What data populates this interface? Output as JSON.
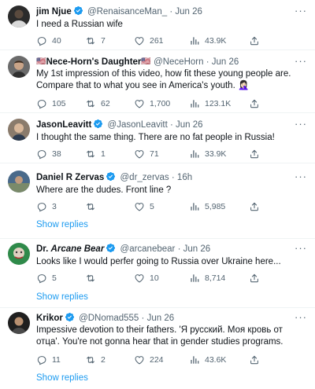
{
  "tweets": [
    {
      "name": "jim Njue",
      "handle": "@RenaisanceMan_",
      "date": "Jun 26",
      "text": "I need a Russian wife",
      "replies": "40",
      "retweets": "7",
      "likes": "261",
      "views": "43.9K"
    },
    {
      "name": "Nece-Horn's Daughter",
      "handle": "@NeceHorn",
      "date": "Jun 26",
      "text": "My 1st impression of this video, how fit these young people are. Compare that to what you see in America's youth. 🤦🏻‍♀️",
      "replies": "105",
      "retweets": "62",
      "likes": "1,700",
      "views": "123.1K"
    },
    {
      "name": "JasonLeavitt",
      "handle": "@JasonLeavitt",
      "date": "Jun 26",
      "text": "I thought the same thing. There are no fat people in Russia!",
      "replies": "38",
      "retweets": "1",
      "likes": "71",
      "views": "33.9K"
    },
    {
      "name": "Daniel R Zervas",
      "handle": "@dr_zervas",
      "date": "16h",
      "text": "Where are the dudes. Front line ?",
      "replies": "3",
      "retweets": "",
      "likes": "5",
      "views": "5,985",
      "show_replies": "Show replies"
    },
    {
      "name_prefix": "Dr. ",
      "name_italic": "Arcane Bear",
      "handle": "@arcanebear",
      "date": "Jun 26",
      "text": "Looks like I would perfer going to Russia over Ukraine here...",
      "replies": "5",
      "retweets": "",
      "likes": "10",
      "views": "8,714",
      "show_replies": "Show replies"
    },
    {
      "name": "Krikor",
      "handle": "@DNomad555",
      "date": "Jun 26",
      "text": "Impessive devotion to their fathers. 'Я русский. Моя кровь от отца'. You're not gonna hear that in gender studies programs.",
      "replies": "11",
      "retweets": "2",
      "likes": "224",
      "views": "43.6K",
      "show_replies": "Show replies"
    }
  ],
  "separator": "·",
  "more_label": "···",
  "colors": {
    "accent": "#1d9bf0",
    "secondary_text": "#536471",
    "text": "#0f1419",
    "divider": "#eff3f4"
  }
}
